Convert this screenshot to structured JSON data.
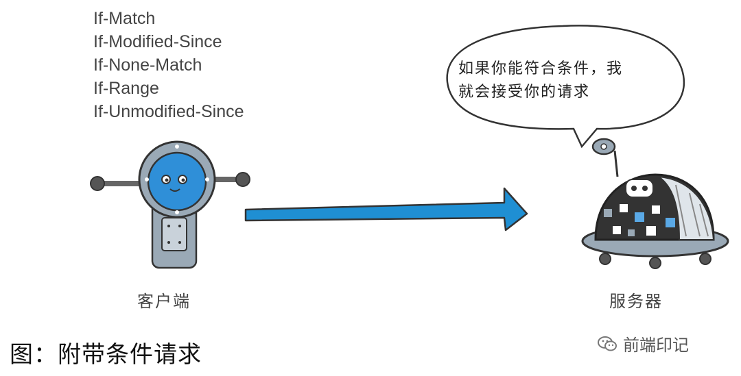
{
  "headers": [
    "If-Match",
    "If-Modified-Since",
    "If-None-Match",
    "If-Range",
    "If-Unmodified-Since"
  ],
  "speech_bubble": {
    "line1": "如果你能符合条件，我",
    "line2": "就会接受你的请求"
  },
  "client_label": "客户端",
  "server_label": "服务器",
  "caption": "图：附带条件请求",
  "watermark": {
    "text": "前端印记",
    "icon": "wechat-icon"
  },
  "colors": {
    "arrow": "#1f8fd3",
    "robot_face": "#2f8fd8",
    "robot_body": "#9aa9b6"
  }
}
